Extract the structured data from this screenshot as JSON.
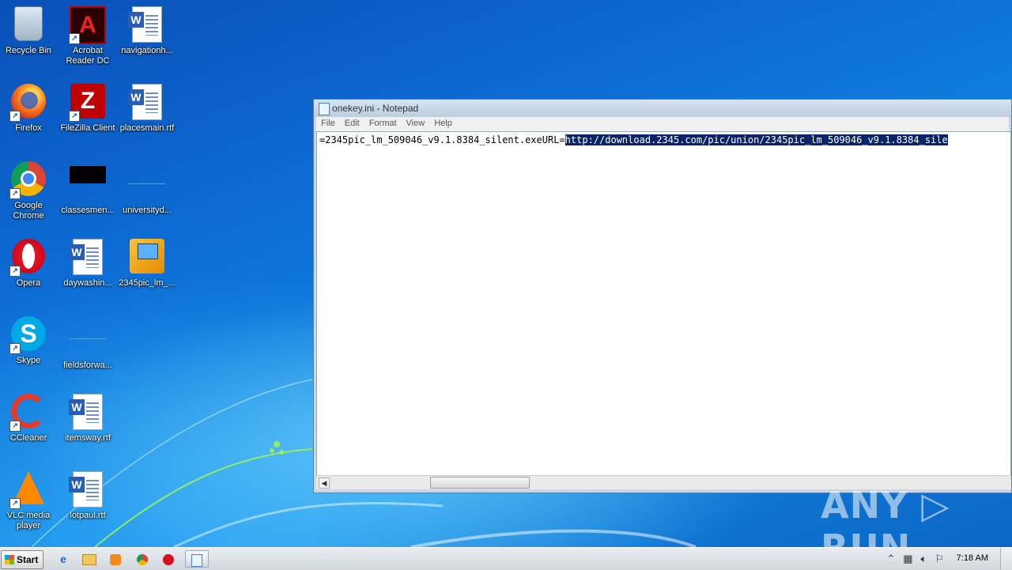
{
  "desktop": {
    "icons": [
      {
        "label": "Recycle Bin"
      },
      {
        "label": "Acrobat Reader DC"
      },
      {
        "label": "navigationh..."
      },
      {
        "label": "Firefox"
      },
      {
        "label": "FileZilla Client"
      },
      {
        "label": "placesmain.rtf"
      },
      {
        "label": "Google Chrome"
      },
      {
        "label": "classesmen..."
      },
      {
        "label": "universityd..."
      },
      {
        "label": "Opera"
      },
      {
        "label": "daywashin..."
      },
      {
        "label": "2345pic_lm_..."
      },
      {
        "label": "Skype"
      },
      {
        "label": "fieldsforwa..."
      },
      {
        "label": "CCleaner"
      },
      {
        "label": "itemsway.rtf"
      },
      {
        "label": "VLC media player"
      },
      {
        "label": "lotpaul.rtf"
      }
    ]
  },
  "notepad": {
    "title": "onekey.ini - Notepad",
    "menu": [
      "File",
      "Edit",
      "Format",
      "View",
      "Help"
    ],
    "text_plain": "=2345pic_lm_509046_v9.1.8384_silent.exeURL=",
    "text_selected": "http://download.2345.com/pic/union/2345pic_lm_509046_v9.1.8384_sile"
  },
  "watermark": "ANY ▷ RUN",
  "taskbar": {
    "start_label": "Start",
    "clock": "7:18 AM",
    "pinned": [
      "internet-explorer-icon",
      "explorer-folder-icon",
      "media-player-icon",
      "chrome-icon",
      "opera-icon",
      "notepad-icon"
    ],
    "tray": [
      "show-hidden-icons-icon",
      "network-icon",
      "volume-icon",
      "action-center-flag-icon"
    ]
  }
}
